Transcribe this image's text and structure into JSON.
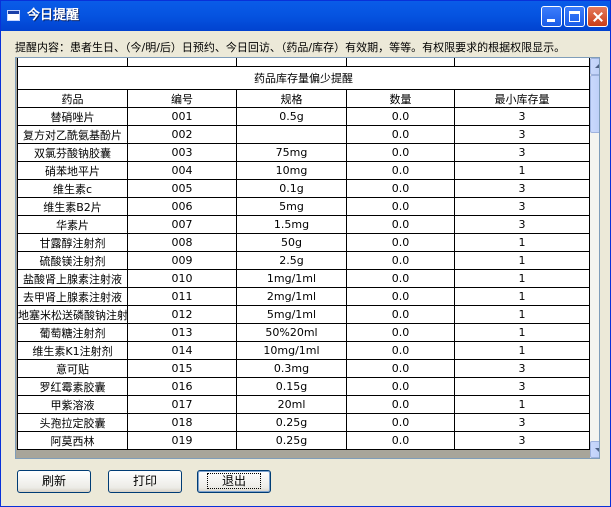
{
  "window": {
    "title": "今日提醒",
    "notice": "提醒内容：患者生日、（今/明/后）日预约、今日回访、（药品/库存）有效期，等等。有权限要求的根据权限显示。"
  },
  "table": {
    "caption": "药品库存量偏少提醒",
    "columns": [
      "药品",
      "编号",
      "规格",
      "数量",
      "最小库存量"
    ],
    "rows": [
      [
        "替硝唑片",
        "001",
        "0.5g",
        "0.0",
        "3"
      ],
      [
        "复方对乙酰氨基酚片",
        "002",
        "",
        "0.0",
        "3"
      ],
      [
        "双氯芬酸钠胶囊",
        "003",
        "75mg",
        "0.0",
        "3"
      ],
      [
        "硝苯地平片",
        "004",
        "10mg",
        "0.0",
        "1"
      ],
      [
        "维生素c",
        "005",
        "0.1g",
        "0.0",
        "3"
      ],
      [
        "维生素B2片",
        "006",
        "5mg",
        "0.0",
        "3"
      ],
      [
        "华素片",
        "007",
        "1.5mg",
        "0.0",
        "3"
      ],
      [
        "甘露醇注射剂",
        "008",
        "50g",
        "0.0",
        "1"
      ],
      [
        "硫酸镁注射剂",
        "009",
        "2.5g",
        "0.0",
        "1"
      ],
      [
        "盐酸肾上腺素注射液",
        "010",
        "1mg/1ml",
        "0.0",
        "1"
      ],
      [
        "去甲肾上腺素注射液",
        "011",
        "2mg/1ml",
        "0.0",
        "1"
      ],
      [
        "地塞米松送磷酸钠注射液",
        "012",
        "5mg/1ml",
        "0.0",
        "1"
      ],
      [
        "葡萄糖注射剂",
        "013",
        "50%20ml",
        "0.0",
        "1"
      ],
      [
        "维生素K1注射剂",
        "014",
        "10mg/1ml",
        "0.0",
        "1"
      ],
      [
        "意可贴",
        "015",
        "0.3mg",
        "0.0",
        "3"
      ],
      [
        "罗红霉素胶囊",
        "016",
        "0.15g",
        "0.0",
        "3"
      ],
      [
        "甲紫溶液",
        "017",
        "20ml",
        "0.0",
        "1"
      ],
      [
        "头孢拉定胶囊",
        "018",
        "0.25g",
        "0.0",
        "3"
      ],
      [
        "阿莫西林",
        "019",
        "0.25g",
        "0.0",
        "3"
      ]
    ]
  },
  "buttons": {
    "refresh": "刷新",
    "print": "打印",
    "quit": "退出"
  },
  "icons": {
    "window": "window-icon",
    "minimize": "minimize-icon",
    "maximize": "maximize-icon",
    "close": "close-icon"
  }
}
